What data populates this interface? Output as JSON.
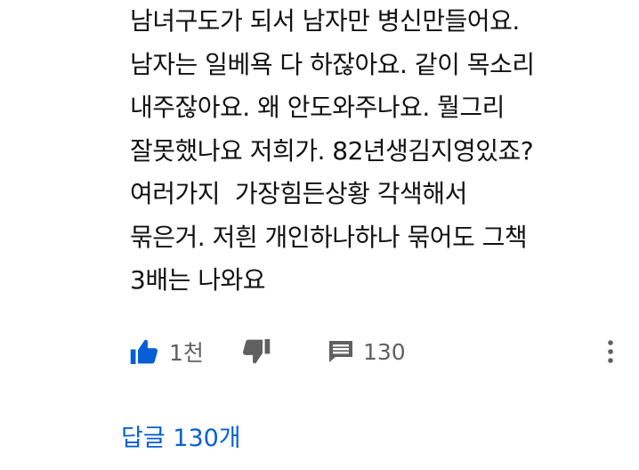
{
  "comment": {
    "lines": [
      "남녀구도가 되서 남자만 병신만들어요.",
      "남자는 일베욕 다 하잖아요. 같이 목소리",
      "내주잖아요. 왜 안도와주나요. 뭘그리",
      "잘못했나요 저희가. 82년생김지영있죠?",
      "여러가지  가장힘든상황 각색해서",
      "묶은거. 저흰 개인하나하나 묶어도 그책",
      "3배는 나와요"
    ]
  },
  "actions": {
    "like_icon": "thumbs-up-icon",
    "like_count": "1천",
    "dislike_icon": "thumbs-down-icon",
    "reply_icon": "comment-icon",
    "reply_count": "130",
    "more_icon": "more-vertical-icon"
  },
  "replies": {
    "label": "답글 130개"
  },
  "colors": {
    "like_active": "#065fd4",
    "icon_gray": "#606060",
    "text": "#111111",
    "link": "#065fd4"
  }
}
